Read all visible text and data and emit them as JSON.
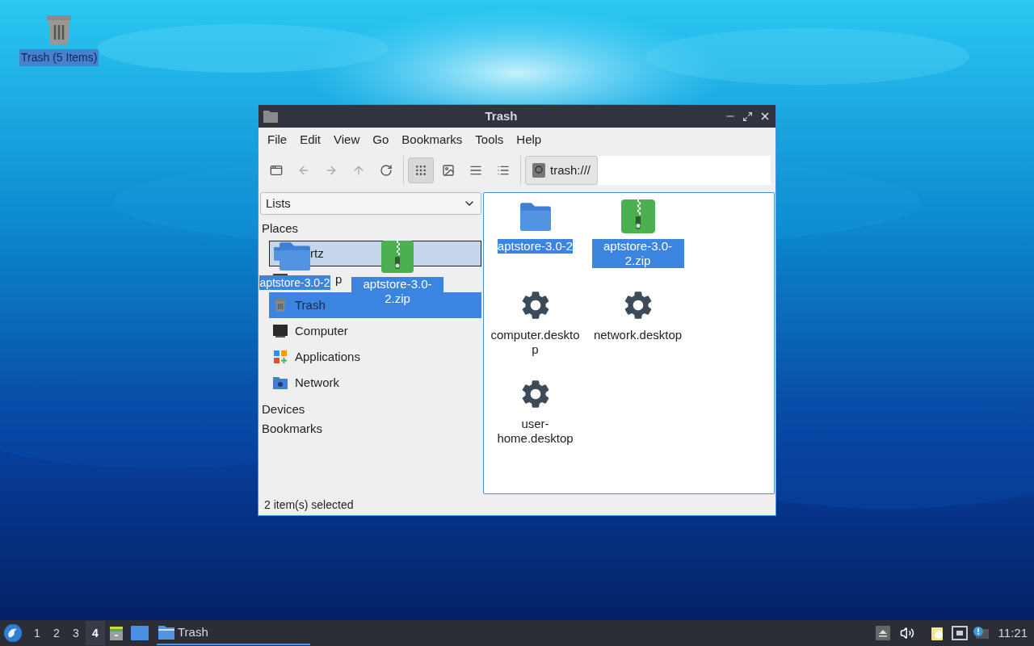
{
  "desktop_icons": [
    {
      "label": "Trash (5 Items)",
      "selected": true
    }
  ],
  "window": {
    "title": "Trash"
  },
  "menu": [
    "File",
    "Edit",
    "View",
    "Go",
    "Bookmarks",
    "Tools",
    "Help"
  ],
  "toolbar": {
    "view_modes": [
      {
        "kind": "icons",
        "selected": true
      },
      {
        "kind": "thumbnails",
        "selected": false
      },
      {
        "kind": "compact",
        "selected": false
      },
      {
        "kind": "list",
        "selected": false
      }
    ],
    "location": "trash:///"
  },
  "side_pane": {
    "mode": "Lists",
    "sections": [
      {
        "title": "Places",
        "items": [
          {
            "label": "rtz",
            "kind": "home",
            "selected": false,
            "focused": true
          },
          {
            "label": "p",
            "kind": "desktop",
            "selected": false,
            "focused": false
          },
          {
            "label": "Trash",
            "kind": "trash",
            "selected": true,
            "focused": false
          },
          {
            "label": "Computer",
            "kind": "computer",
            "selected": false,
            "focused": false
          },
          {
            "label": "Applications",
            "kind": "applications",
            "selected": false,
            "focused": false
          },
          {
            "label": "Network",
            "kind": "network",
            "selected": false,
            "focused": false
          }
        ]
      },
      {
        "title": "Devices"
      },
      {
        "title": "Bookmarks"
      }
    ]
  },
  "files": [
    {
      "name": "aptstore-3.0-2",
      "kind": "folder",
      "selected": true
    },
    {
      "name": "aptstore-3.0-2.zip",
      "kind": "archive",
      "selected": true
    },
    {
      "name": "computer.desktop",
      "kind": "settings",
      "selected": false
    },
    {
      "name": "network.desktop",
      "kind": "settings",
      "selected": false
    },
    {
      "name": "user-home.desktop",
      "kind": "settings",
      "selected": false
    }
  ],
  "drag": [
    {
      "name": "aptstore-3.0-2",
      "kind": "folder"
    },
    {
      "name": "aptstore-3.0-2.zip",
      "kind": "archive"
    }
  ],
  "status_bar": "2 item(s) selected",
  "taskbar": {
    "workspaces": [
      {
        "label": "1",
        "selected": false
      },
      {
        "label": "2",
        "selected": false
      },
      {
        "label": "3",
        "selected": false
      },
      {
        "label": "4",
        "selected": true
      }
    ],
    "tasks": [
      {
        "label": "Trash",
        "selected": true
      }
    ],
    "clock": "11:21"
  }
}
